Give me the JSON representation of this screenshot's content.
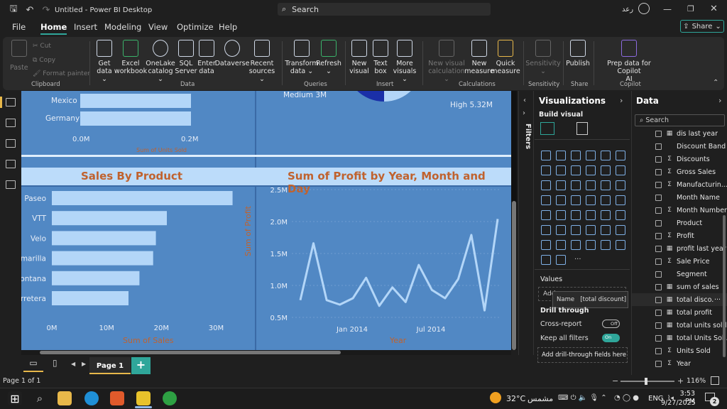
{
  "titlebar": {
    "title": "Untitled - Power BI Desktop",
    "search_placeholder": "Search",
    "user": "رعد"
  },
  "menu": {
    "items": [
      "File",
      "Home",
      "Insert",
      "Modeling",
      "View",
      "Optimize",
      "Help"
    ],
    "active": "Home",
    "share": "Share"
  },
  "ribbon": {
    "clipboard": {
      "paste": "Paste",
      "cut": "Cut",
      "copy": "Copy",
      "format_painter": "Format painter",
      "group": "Clipboard"
    },
    "data": {
      "get_data": "Get data ⌄",
      "excel": "Excel workbook",
      "onelake": "OneLake catalog ⌄",
      "sql": "SQL Server",
      "enter": "Enter data",
      "dataverse": "Dataverse",
      "recent": "Recent sources ⌄",
      "group": "Data"
    },
    "queries": {
      "transform": "Transform data ⌄",
      "refresh": "Refresh ⌄",
      "group": "Queries"
    },
    "insert": {
      "new_visual": "New visual",
      "text_box": "Text box",
      "more_visuals": "More visuals ⌄",
      "group": "Insert"
    },
    "calculations": {
      "new_visual_calc": "New visual calculation ⌄",
      "new_measure": "New measure",
      "quick_measure": "Quick measure",
      "group": "Calculations"
    },
    "sensitivity": {
      "label": "Sensitivity ⌄",
      "group": "Sensitivity"
    },
    "share": {
      "publish": "Publish",
      "group": "Share"
    },
    "copilot": {
      "prep": "Prep data for Copilot",
      "ai": "AI",
      "group": "Copilot"
    }
  },
  "canvas": {
    "top_left": {
      "rows": [
        "Mexico",
        "Germany"
      ],
      "axis": [
        "0.0M",
        "0.2M"
      ],
      "axis_title": "Sum of Units Sold"
    },
    "donut": {
      "medium": "Medium 3M",
      "high": "High 5.32M"
    },
    "sales_by_product": {
      "title": "Sales By Product",
      "axis_title": "Sum of Sales",
      "ticks": [
        "0M",
        "10M",
        "20M",
        "30M"
      ]
    },
    "profit_chart": {
      "title": "Sum of Profit by Year, Month and Day",
      "ylabel": "Sum of Profit",
      "xlabel": "Year",
      "yticks": [
        "2.5M",
        "2.0M",
        "1.5M",
        "1.0M",
        "0.5M"
      ],
      "xticks": [
        "Jan 2014",
        "Jul 2014"
      ]
    }
  },
  "chart_data": [
    {
      "type": "bar",
      "title": "Sales By Product",
      "xlabel": "Sum of Sales",
      "ylabel": "",
      "categories": [
        "Paseo",
        "VTT",
        "Velo",
        "Amarilla",
        "Montana",
        "Carretera"
      ],
      "values": [
        33,
        21,
        19,
        18.5,
        16,
        14
      ],
      "xlim": [
        0,
        35
      ]
    },
    {
      "type": "line",
      "title": "Sum of Profit by Year, Month and Day",
      "xlabel": "Year",
      "ylabel": "Sum of Profit",
      "ylim": [
        0.5,
        2.5
      ],
      "values": [
        0.77,
        1.66,
        0.77,
        0.7,
        0.8,
        1.12,
        0.68,
        0.97,
        0.74,
        1.32,
        0.93,
        0.8,
        1.1,
        1.79,
        0.61,
        2.04
      ]
    },
    {
      "type": "bar",
      "categories": [
        "Mexico",
        "Germany"
      ],
      "values": [
        0.2,
        0.2
      ],
      "xlabel": "Sum of Units Sold"
    }
  ],
  "filters": {
    "label": "Filters"
  },
  "visualizations": {
    "title": "Visualizations",
    "build": "Build visual",
    "values": "Values",
    "add_field": "Add",
    "tooltip_name": "Name",
    "tooltip_value": "[total discount]",
    "drill": "Drill through",
    "cross_report": "Cross-report",
    "cross_state": "Off",
    "keep_filters": "Keep all filters",
    "keep_state": "On",
    "add_drill": "Add drill-through fields here"
  },
  "data": {
    "title": "Data",
    "search_placeholder": "Search",
    "fields": [
      {
        "type": "▦",
        "name": "dis last year"
      },
      {
        "type": "",
        "name": "Discount Band"
      },
      {
        "type": "Σ",
        "name": "Discounts"
      },
      {
        "type": "Σ",
        "name": "Gross Sales"
      },
      {
        "type": "Σ",
        "name": "Manufacturin..."
      },
      {
        "type": "",
        "name": "Month Name"
      },
      {
        "type": "Σ",
        "name": "Month Number"
      },
      {
        "type": "",
        "name": "Product"
      },
      {
        "type": "Σ",
        "name": "Profit"
      },
      {
        "type": "▦",
        "name": "profit last year"
      },
      {
        "type": "Σ",
        "name": "Sale Price"
      },
      {
        "type": "",
        "name": "Segment"
      },
      {
        "type": "▦",
        "name": "sum of sales"
      },
      {
        "type": "▦",
        "name": "total disco..."
      },
      {
        "type": "▦",
        "name": "total profit"
      },
      {
        "type": "▦",
        "name": "total units sold"
      },
      {
        "type": "▦",
        "name": "total Units Sol..."
      },
      {
        "type": "Σ",
        "name": "Units Sold"
      },
      {
        "type": "Σ",
        "name": "Year"
      }
    ]
  },
  "pages": {
    "tab": "Page 1",
    "status": "Page 1 of 1",
    "zoom": "116%"
  },
  "taskbar": {
    "temp": "32°C",
    "weather": "مشمس",
    "lang": "ENG",
    "time": "3:53 PM",
    "date": "9/27/2025",
    "badge": "2"
  }
}
